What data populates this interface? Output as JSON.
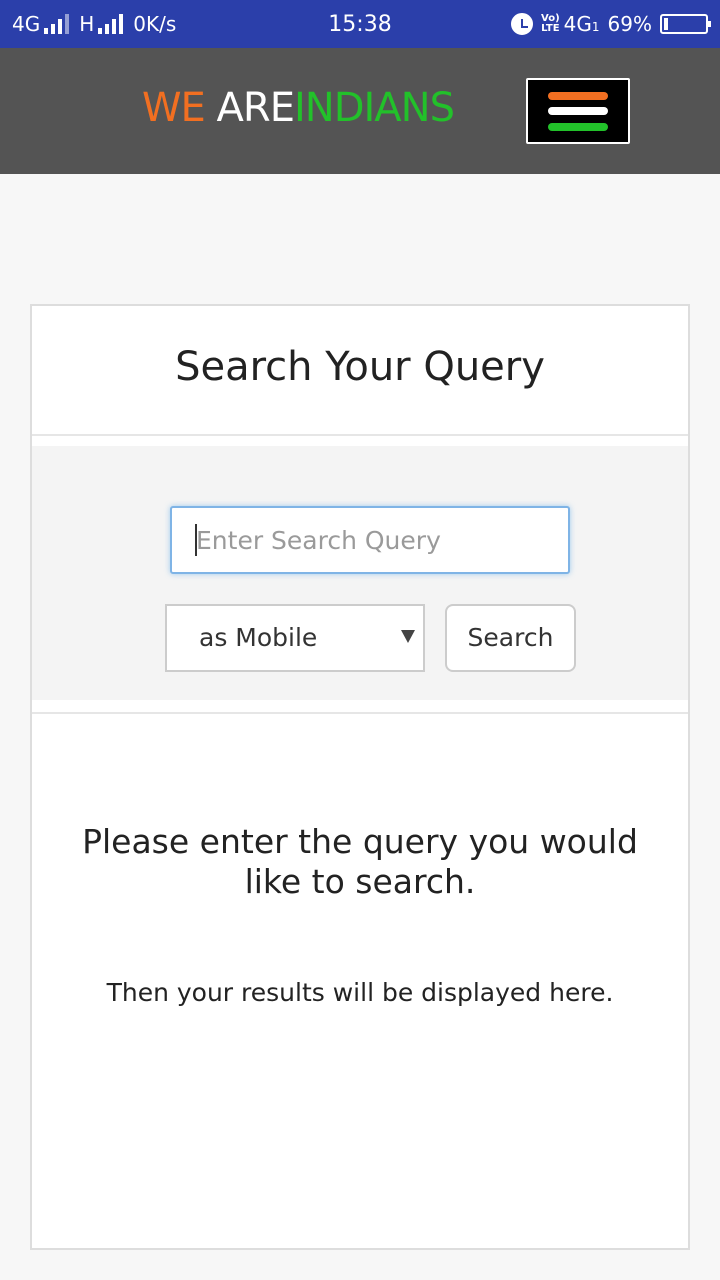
{
  "status_bar": {
    "network1": "4G",
    "network2": "H",
    "speed": "0K/s",
    "time": "15:38",
    "volte_top": "Vo)",
    "volte_bottom": "LTE",
    "network3": "4G",
    "network3_sub": "1",
    "battery": "69%"
  },
  "header": {
    "brand_part1": "WE",
    "brand_part2": "ARE",
    "brand_part3": "INDIANS",
    "colors": {
      "saffron": "#f26f21",
      "white": "#ffffff",
      "green": "#22c12a",
      "header_bg": "#545454",
      "status_bg": "#2b3faa"
    }
  },
  "card": {
    "title": "Search Your Query",
    "search": {
      "placeholder": "Enter Search Query",
      "value": "",
      "select_value": "as Mobile",
      "button_label": "Search"
    },
    "message": "Please enter the query you would like to search.",
    "submessage": "Then your results will be displayed here."
  }
}
